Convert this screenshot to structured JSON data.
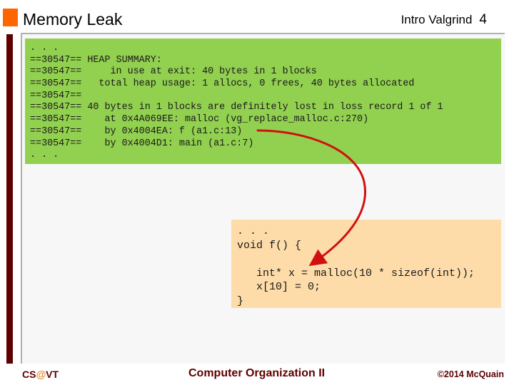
{
  "header": {
    "title": "Memory Leak",
    "section": "Intro Valgrind",
    "page_number": "4"
  },
  "valgrind_output": {
    "lines": [
      ". . .",
      "==30547== HEAP SUMMARY:",
      "==30547==     in use at exit: 40 bytes in 1 blocks",
      "==30547==   total heap usage: 1 allocs, 0 frees, 40 bytes allocated",
      "==30547==",
      "==30547== 40 bytes in 1 blocks are definitely lost in loss record 1 of 1",
      "==30547==    at 0x4A069EE: malloc (vg_replace_malloc.c:270)",
      "==30547==    by 0x4004EA: f (a1.c:13)",
      "==30547==    by 0x4004D1: main (a1.c:7)",
      ". . ."
    ]
  },
  "source_code": {
    "lines": [
      ". . .",
      "void f() {",
      "",
      "   int* x = malloc(10 * sizeof(int));",
      "   x[10] = 0;",
      "}"
    ]
  },
  "annotation": {
    "arrow_color": "#d01010",
    "from": "by 0x4004EA: f (a1.c:13)",
    "to": "int* x = malloc(10 * sizeof(int));"
  },
  "footer": {
    "left_prefix": "CS",
    "left_at": "@",
    "left_suffix": "VT",
    "center": "Computer Organization II",
    "right": "©2014 McQuain"
  },
  "colors": {
    "accent_orange": "#ff6600",
    "maroon": "#5e0000",
    "green_box": "#92d050",
    "peach_box": "#fddcaa"
  }
}
